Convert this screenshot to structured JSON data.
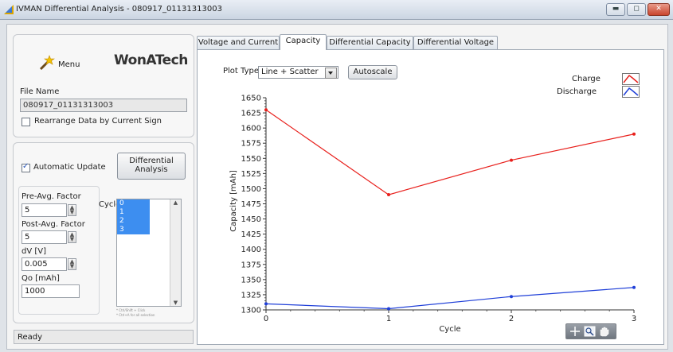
{
  "window": {
    "title": "IVMAN Differential Analysis - 080917_01131313003"
  },
  "left": {
    "menu_label": "Menu",
    "logo_text": "WonATech",
    "file_name_label": "File Name",
    "file_name_value": "080917_01131313003",
    "rearrange_label": "Rearrange Data by Current Sign",
    "rearrange_checked": false,
    "auto_update_label": "Automatic Update",
    "auto_update_checked": true,
    "diff_button_line1": "Differential",
    "diff_button_line2": "Analysis",
    "pre_avg_label": "Pre-Avg. Factor",
    "pre_avg_value": "5",
    "post_avg_label": "Post-Avg. Factor",
    "post_avg_value": "5",
    "dv_label": "dV [V]",
    "dv_value": "0.005",
    "qo_label": "Qo [mAh]",
    "qo_value": "1000",
    "cycle_label": "Cycle",
    "cycles": [
      "0",
      "1",
      "2",
      "3"
    ],
    "hint_line1": "* Ctrl/Shift + Click",
    "hint_line2": "* Ctrl+A for all selection"
  },
  "tabs": [
    "Voltage and Current",
    "Capacity",
    "Differential Capacity",
    "Differential Voltage"
  ],
  "active_tab": "Capacity",
  "plot_controls": {
    "plot_type_label": "Plot Type",
    "plot_type_value": "Line + Scatter",
    "autoscale_label": "Autoscale"
  },
  "status": {
    "text": "Ready"
  },
  "chart_data": {
    "type": "line",
    "xlabel": "Cycle",
    "ylabel": "Capacity [mAh]",
    "x": [
      0,
      1,
      2,
      3
    ],
    "xlim": [
      0,
      3
    ],
    "ylim": [
      1300,
      1650
    ],
    "x_ticks": [
      "0",
      "1",
      "2",
      "3"
    ],
    "y_ticks": [
      "1300",
      "1325",
      "1350",
      "1375",
      "1400",
      "1425",
      "1450",
      "1475",
      "1500",
      "1525",
      "1550",
      "1575",
      "1600",
      "1625",
      "1650"
    ],
    "grid": false,
    "legend_placement": "top-right",
    "series": [
      {
        "name": "Charge",
        "color": "#e8201c",
        "values": [
          1630,
          1490,
          1547,
          1590
        ]
      },
      {
        "name": "Discharge",
        "color": "#1f3fd8",
        "values": [
          1310,
          1302,
          1322,
          1337
        ]
      }
    ]
  },
  "icons": {
    "app": "app-icon",
    "menu": "magic-wand-icon",
    "graph_tools": [
      "crosshair-icon",
      "zoom-icon",
      "pan-hand-icon"
    ]
  }
}
